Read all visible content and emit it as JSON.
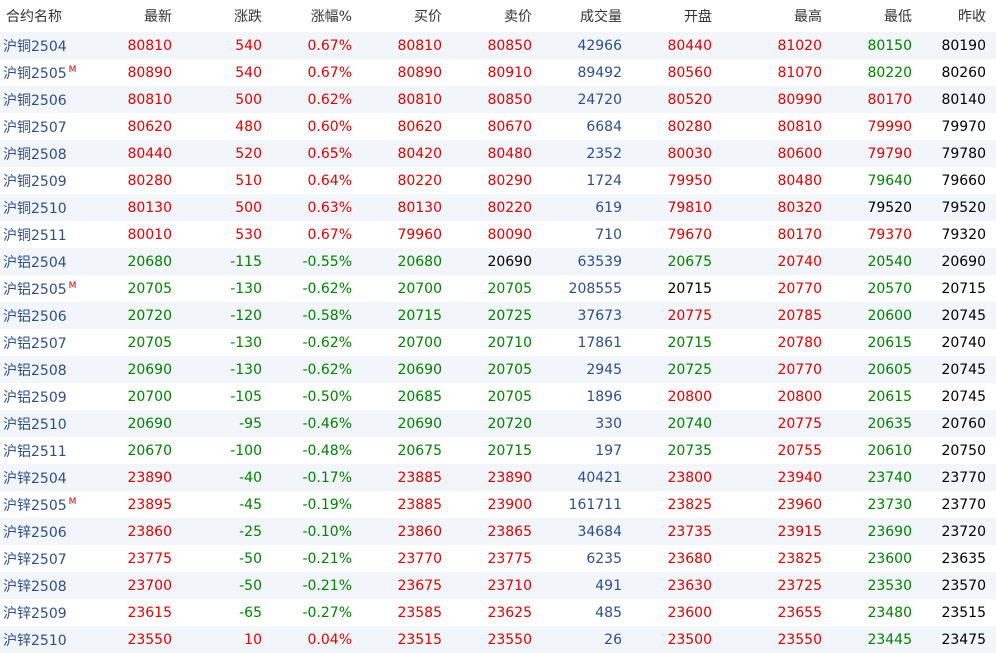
{
  "headers": [
    "合约名称",
    "最新",
    "涨跌",
    "涨幅%",
    "买价",
    "卖价",
    "成交量",
    "开盘",
    "最高",
    "最低",
    "昨收"
  ],
  "colors": {
    "up": "#e00000",
    "down": "#008000",
    "flat": "#000000",
    "volume": "#2c4f8a",
    "name": "#2c4f8a"
  },
  "main_marker": "M",
  "rows": [
    {
      "name": "沪铜2504",
      "main": false,
      "last": "80810",
      "chg": "540",
      "pct": "0.67%",
      "bid": "80810",
      "ask": "80850",
      "vol": "42966",
      "open": "80440",
      "high": "81020",
      "low": "80150",
      "prev": "80190"
    },
    {
      "name": "沪铜2505",
      "main": true,
      "last": "80890",
      "chg": "540",
      "pct": "0.67%",
      "bid": "80890",
      "ask": "80910",
      "vol": "89492",
      "open": "80560",
      "high": "81070",
      "low": "80220",
      "prev": "80260"
    },
    {
      "name": "沪铜2506",
      "main": false,
      "last": "80810",
      "chg": "500",
      "pct": "0.62%",
      "bid": "80810",
      "ask": "80850",
      "vol": "24720",
      "open": "80520",
      "high": "80990",
      "low": "80170",
      "prev": "80140"
    },
    {
      "name": "沪铜2507",
      "main": false,
      "last": "80620",
      "chg": "480",
      "pct": "0.60%",
      "bid": "80620",
      "ask": "80670",
      "vol": "6684",
      "open": "80280",
      "high": "80810",
      "low": "79990",
      "prev": "79970"
    },
    {
      "name": "沪铜2508",
      "main": false,
      "last": "80440",
      "chg": "520",
      "pct": "0.65%",
      "bid": "80420",
      "ask": "80480",
      "vol": "2352",
      "open": "80030",
      "high": "80600",
      "low": "79790",
      "prev": "79780"
    },
    {
      "name": "沪铜2509",
      "main": false,
      "last": "80280",
      "chg": "510",
      "pct": "0.64%",
      "bid": "80220",
      "ask": "80290",
      "vol": "1724",
      "open": "79950",
      "high": "80480",
      "low": "79640",
      "prev": "79660"
    },
    {
      "name": "沪铜2510",
      "main": false,
      "last": "80130",
      "chg": "500",
      "pct": "0.63%",
      "bid": "80130",
      "ask": "80220",
      "vol": "619",
      "open": "79810",
      "high": "80320",
      "low": "79520",
      "prev": "79520"
    },
    {
      "name": "沪铜2511",
      "main": false,
      "last": "80010",
      "chg": "530",
      "pct": "0.67%",
      "bid": "79960",
      "ask": "80090",
      "vol": "710",
      "open": "79670",
      "high": "80170",
      "low": "79370",
      "prev": "79320"
    },
    {
      "name": "沪铝2504",
      "main": false,
      "last": "20680",
      "chg": "-115",
      "pct": "-0.55%",
      "bid": "20680",
      "ask": "20690",
      "vol": "63539",
      "open": "20675",
      "high": "20740",
      "low": "20540",
      "prev": "20690"
    },
    {
      "name": "沪铝2505",
      "main": true,
      "last": "20705",
      "chg": "-130",
      "pct": "-0.62%",
      "bid": "20700",
      "ask": "20705",
      "vol": "208555",
      "open": "20715",
      "high": "20770",
      "low": "20570",
      "prev": "20715"
    },
    {
      "name": "沪铝2506",
      "main": false,
      "last": "20720",
      "chg": "-120",
      "pct": "-0.58%",
      "bid": "20715",
      "ask": "20725",
      "vol": "37673",
      "open": "20775",
      "high": "20785",
      "low": "20600",
      "prev": "20745"
    },
    {
      "name": "沪铝2507",
      "main": false,
      "last": "20705",
      "chg": "-130",
      "pct": "-0.62%",
      "bid": "20700",
      "ask": "20710",
      "vol": "17861",
      "open": "20715",
      "high": "20780",
      "low": "20615",
      "prev": "20740"
    },
    {
      "name": "沪铝2508",
      "main": false,
      "last": "20690",
      "chg": "-130",
      "pct": "-0.62%",
      "bid": "20690",
      "ask": "20705",
      "vol": "2945",
      "open": "20725",
      "high": "20770",
      "low": "20605",
      "prev": "20745"
    },
    {
      "name": "沪铝2509",
      "main": false,
      "last": "20700",
      "chg": "-105",
      "pct": "-0.50%",
      "bid": "20685",
      "ask": "20705",
      "vol": "1896",
      "open": "20800",
      "high": "20800",
      "low": "20615",
      "prev": "20745"
    },
    {
      "name": "沪铝2510",
      "main": false,
      "last": "20690",
      "chg": "-95",
      "pct": "-0.46%",
      "bid": "20690",
      "ask": "20720",
      "vol": "330",
      "open": "20740",
      "high": "20775",
      "low": "20635",
      "prev": "20760"
    },
    {
      "name": "沪铝2511",
      "main": false,
      "last": "20670",
      "chg": "-100",
      "pct": "-0.48%",
      "bid": "20675",
      "ask": "20715",
      "vol": "197",
      "open": "20735",
      "high": "20755",
      "low": "20610",
      "prev": "20750"
    },
    {
      "name": "沪锌2504",
      "main": false,
      "last": "23890",
      "chg": "-40",
      "pct": "-0.17%",
      "bid": "23885",
      "ask": "23890",
      "vol": "40421",
      "open": "23800",
      "high": "23940",
      "low": "23740",
      "prev": "23770"
    },
    {
      "name": "沪锌2505",
      "main": true,
      "last": "23895",
      "chg": "-45",
      "pct": "-0.19%",
      "bid": "23885",
      "ask": "23900",
      "vol": "161711",
      "open": "23825",
      "high": "23960",
      "low": "23730",
      "prev": "23770"
    },
    {
      "name": "沪锌2506",
      "main": false,
      "last": "23860",
      "chg": "-25",
      "pct": "-0.10%",
      "bid": "23860",
      "ask": "23865",
      "vol": "34684",
      "open": "23735",
      "high": "23915",
      "low": "23690",
      "prev": "23720"
    },
    {
      "name": "沪锌2507",
      "main": false,
      "last": "23775",
      "chg": "-50",
      "pct": "-0.21%",
      "bid": "23770",
      "ask": "23775",
      "vol": "6235",
      "open": "23680",
      "high": "23825",
      "low": "23600",
      "prev": "23635"
    },
    {
      "name": "沪锌2508",
      "main": false,
      "last": "23700",
      "chg": "-50",
      "pct": "-0.21%",
      "bid": "23675",
      "ask": "23710",
      "vol": "491",
      "open": "23630",
      "high": "23725",
      "low": "23530",
      "prev": "23570"
    },
    {
      "name": "沪锌2509",
      "main": false,
      "last": "23615",
      "chg": "-65",
      "pct": "-0.27%",
      "bid": "23585",
      "ask": "23625",
      "vol": "485",
      "open": "23600",
      "high": "23655",
      "low": "23480",
      "prev": "23515"
    },
    {
      "name": "沪锌2510",
      "main": false,
      "last": "23550",
      "chg": "10",
      "pct": "0.04%",
      "bid": "23515",
      "ask": "23550",
      "vol": "26",
      "open": "23500",
      "high": "23550",
      "low": "23445",
      "prev": "23475"
    }
  ]
}
